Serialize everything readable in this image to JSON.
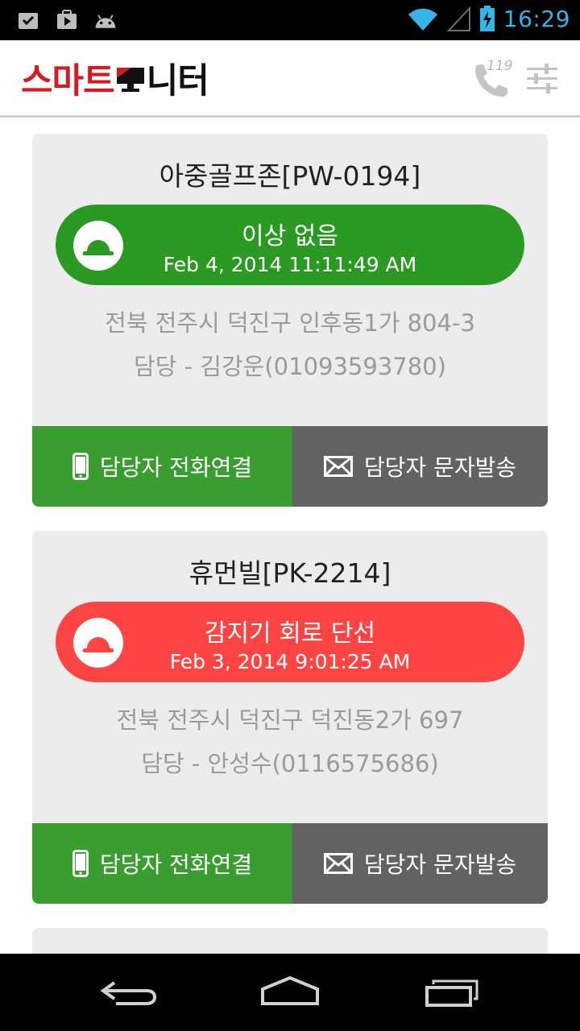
{
  "status_bar": {
    "time": "16:29",
    "left_icons": [
      "download-done-icon",
      "play-store-icon",
      "android-icon"
    ],
    "right_icons": [
      "wifi-icon",
      "signal-icon",
      "battery-charging-icon"
    ]
  },
  "app_bar": {
    "logo_red": "스마트",
    "logo_black": "니터",
    "call_label": "119",
    "colors": {
      "logo_red": "#d71920",
      "logo_black": "#111111"
    }
  },
  "cards": [
    {
      "title": "아중골프존[PW-0194]",
      "status": "이상 없음",
      "time": "Feb 4, 2014 11:11:49 AM",
      "status_type": "ok",
      "address": "전북 전주시 덕진구 인후동1가 804-3",
      "manager": "담당 - 김강운(01093593780)",
      "call_label": "담당자 전화연결",
      "sms_label": "담당자 문자발송"
    },
    {
      "title": "휴먼빌[PK-2214]",
      "status": "감지기 회로 단선",
      "time": "Feb 3, 2014 9:01:25 AM",
      "status_type": "alert",
      "address": "전북 전주시 덕진구 덕진동2가 697",
      "manager": "담당 - 안성수(0116575686)",
      "call_label": "담당자 전화연결",
      "sms_label": "담당자 문자발송"
    }
  ],
  "partial_card": {
    "title": ""
  },
  "colors": {
    "ok": "#2a9a22",
    "alert": "#ff4444",
    "call_button": "#3a9d2f",
    "sms_button": "#626262",
    "card_bg": "#ececec",
    "accent": "#33b5e5"
  },
  "nav_bar": {
    "icons": [
      "back-icon",
      "home-icon",
      "recent-apps-icon"
    ]
  }
}
